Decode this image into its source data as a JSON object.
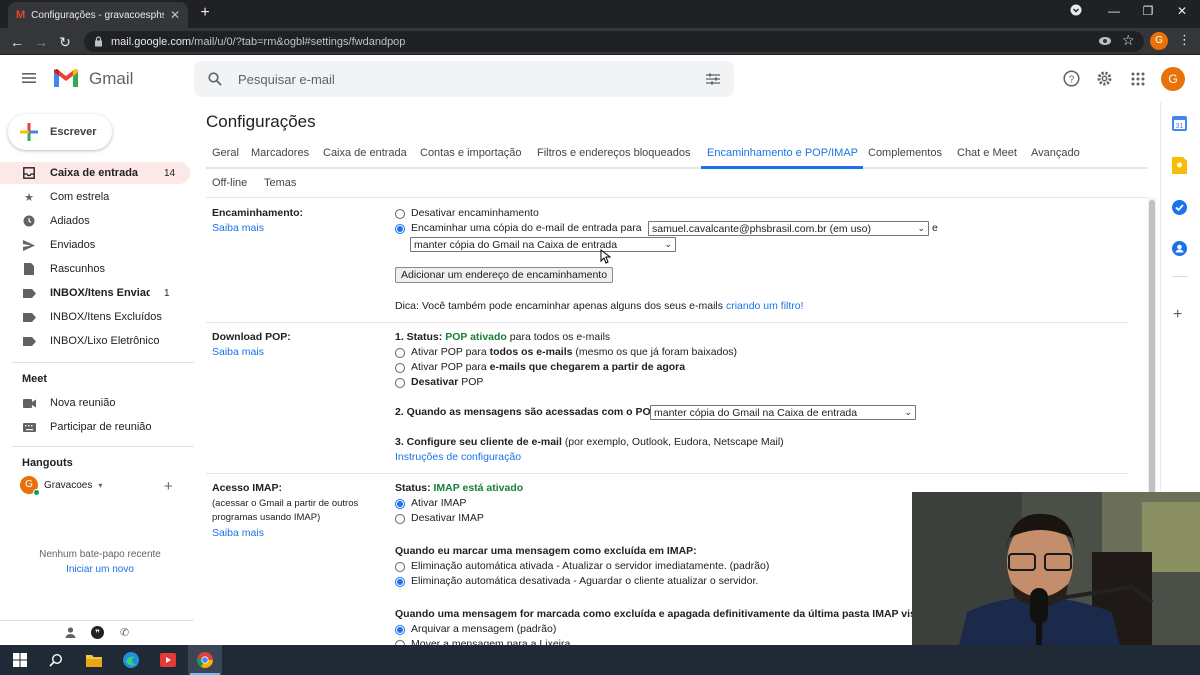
{
  "browser": {
    "tab_title": "Configurações - gravacoesphsbr...",
    "url_host": "mail.google.com",
    "url_path": "/mail/u/0/?tab=rm&ogbl#settings/fwdandpop",
    "profile_initial": "G"
  },
  "header": {
    "app_name": "Gmail",
    "search_placeholder": "Pesquisar e-mail",
    "avatar_initial": "G"
  },
  "sidebar": {
    "compose_label": "Escrever",
    "items": [
      {
        "label": "Caixa de entrada",
        "count": "14",
        "icon": "inbox-icon",
        "bold": true
      },
      {
        "label": "Com estrela",
        "count": "",
        "icon": "star-icon"
      },
      {
        "label": "Adiados",
        "count": "",
        "icon": "clock-icon"
      },
      {
        "label": "Enviados",
        "count": "",
        "icon": "send-icon"
      },
      {
        "label": "Rascunhos",
        "count": "",
        "icon": "draft-icon"
      },
      {
        "label": "INBOX/Itens Enviad...",
        "count": "1",
        "icon": "label-icon",
        "bold": true
      },
      {
        "label": "INBOX/Itens Excluídos",
        "count": "",
        "icon": "label-icon"
      },
      {
        "label": "INBOX/Lixo Eletrônico",
        "count": "",
        "icon": "label-icon"
      }
    ],
    "meet_title": "Meet",
    "meet_items": [
      {
        "label": "Nova reunião",
        "icon": "video-icon"
      },
      {
        "label": "Participar de reunião",
        "icon": "keyboard-icon"
      }
    ],
    "hangouts_title": "Hangouts",
    "hangouts_user": "Gravacoes",
    "hangouts_initial": "G",
    "no_chat_text": "Nenhum bate-papo recente",
    "start_new_link": "Iniciar um novo"
  },
  "settings": {
    "title": "Configurações",
    "tabs": [
      {
        "label": "Geral"
      },
      {
        "label": "Marcadores"
      },
      {
        "label": "Caixa de entrada"
      },
      {
        "label": "Contas e importação"
      },
      {
        "label": "Filtros e endereços bloqueados"
      },
      {
        "label": "Encaminhamento e POP/IMAP",
        "active": true
      },
      {
        "label": "Complementos"
      },
      {
        "label": "Chat e Meet"
      },
      {
        "label": "Avançado"
      },
      {
        "label": "Off-line"
      },
      {
        "label": "Temas"
      }
    ],
    "forwarding": {
      "label": "Encaminhamento:",
      "learn_more": "Saiba mais",
      "opt_disable": "Desativar encaminhamento",
      "opt_forward": "Encaminhar uma cópia do e-mail de entrada para",
      "forward_address": "samuel.cavalcante@phsbrasil.com.br (em uso)",
      "and_text": "e",
      "keep_copy": "manter cópia do Gmail na Caixa de entrada",
      "add_button": "Adicionar um endereço de encaminhamento",
      "tip_text": "Dica: Você também pode encaminhar apenas alguns dos seus e-mails",
      "tip_link": "criando um filtro!"
    },
    "pop": {
      "label": "Download POP:",
      "learn_more": "Saiba mais",
      "status_prefix": "1. Status:",
      "status_value": "POP ativado",
      "status_suffix": "para todos os e-mails",
      "opt1_a": "Ativar POP para",
      "opt1_b": "todos os e-mails",
      "opt1_c": "(mesmo os que já foram baixados)",
      "opt2_a": "Ativar POP para",
      "opt2_b": "e-mails que chegarem a partir de agora",
      "opt3_a": "Desativar",
      "opt3_b": "POP",
      "q2": "2. Quando as mensagens são acessadas com o POP",
      "q2_select": "manter cópia do Gmail na Caixa de entrada",
      "q3_a": "3. Configure seu cliente de e-mail",
      "q3_b": "(por exemplo, Outlook, Eudora, Netscape Mail)",
      "config_link": "Instruções de configuração"
    },
    "imap": {
      "label": "Acesso IMAP:",
      "desc": "(acessar o Gmail a partir de outros programas usando IMAP)",
      "learn_more": "Saiba mais",
      "status_prefix": "Status:",
      "status_value": "IMAP está ativado",
      "opt_enable": "Ativar IMAP",
      "opt_disable": "Desativar IMAP",
      "q_deleted": "Quando eu marcar uma mensagem como excluída em IMAP:",
      "del_opt1": "Eliminação automática ativada - Atualizar o servidor imediatamente. (padrão)",
      "del_opt2": "Eliminação automática desativada - Aguardar o cliente atualizar o servidor.",
      "q_expunged": "Quando uma mensagem for marcada como excluída e apagada definitivamente da última pasta IMAP visível",
      "exp_opt1": "Arquivar a mensagem (padrão)",
      "exp_opt2": "Mover a mensagem para a Lixeira"
    }
  },
  "colors": {
    "accent": "#1a73e8",
    "green": "#188038",
    "avatar": "#e8710a"
  }
}
